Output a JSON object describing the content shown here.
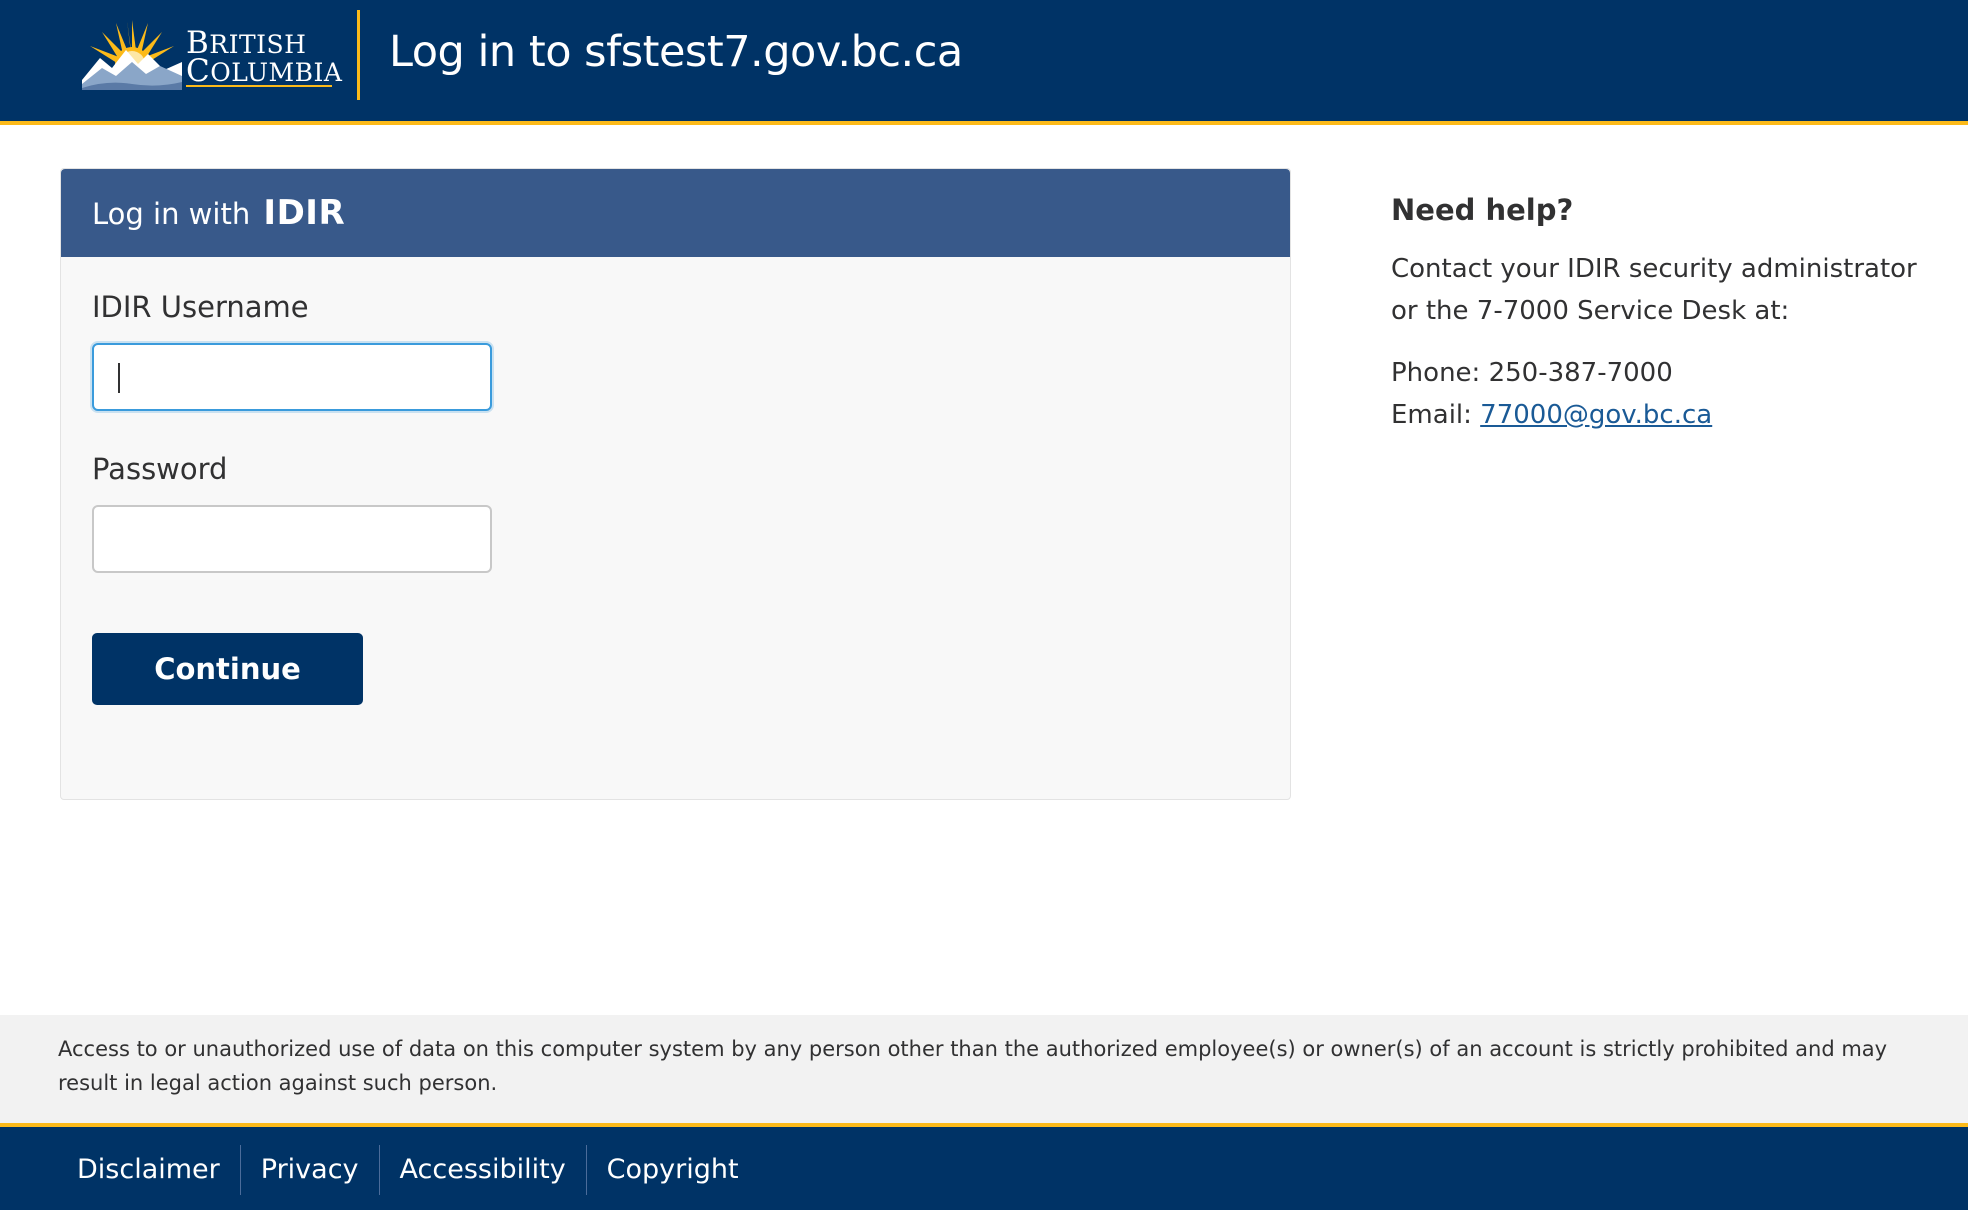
{
  "colors": {
    "header_bg": "#003366",
    "accent_gold": "#fcba19",
    "panel_head_bg": "#38598a",
    "button_bg": "#003366",
    "link": "#1a5a96"
  },
  "header": {
    "logo": {
      "line1": "British",
      "line2": "Columbia",
      "icon": "bc-sun-mountains-logo"
    },
    "title": "Log in to sfstest7.gov.bc.ca"
  },
  "login": {
    "heading_prefix": "Log in with",
    "heading_brand": "IDIR",
    "username_label": "IDIR Username",
    "username_value": "",
    "password_label": "Password",
    "password_value": "",
    "continue_label": "Continue"
  },
  "help": {
    "title": "Need help?",
    "body": "Contact your IDIR security administrator or the 7-7000 Service Desk at:",
    "phone_label": "Phone:",
    "phone": "250-387-7000",
    "email_label": "Email:",
    "email": "77000@gov.bc.ca"
  },
  "notice": {
    "text": "Access to or unauthorized use of data on this computer system by any person other than the authorized employee(s) or owner(s) of an account is strictly prohibited and may result in legal action against such person."
  },
  "footer": {
    "links": [
      "Disclaimer",
      "Privacy",
      "Accessibility",
      "Copyright"
    ]
  }
}
